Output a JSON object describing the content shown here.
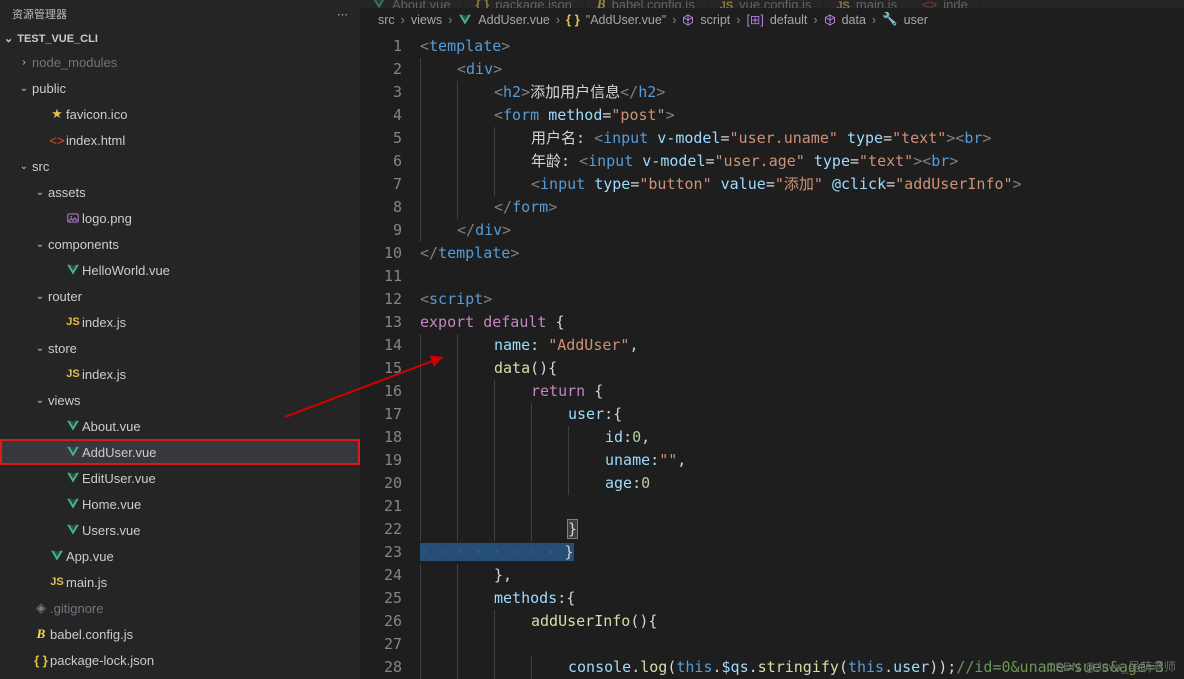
{
  "explorer_title": "资源管理器",
  "project": "TEST_VUE_CLI",
  "tree": [
    {
      "d": 1,
      "c": ">",
      "t": "folder",
      "l": "node_modules",
      "dim": true
    },
    {
      "d": 1,
      "c": "v",
      "t": "folder",
      "l": "public"
    },
    {
      "d": 2,
      "c": "",
      "t": "star",
      "l": "favicon.ico"
    },
    {
      "d": 2,
      "c": "",
      "t": "html",
      "l": "index.html"
    },
    {
      "d": 1,
      "c": "v",
      "t": "folder",
      "l": "src"
    },
    {
      "d": 2,
      "c": "v",
      "t": "folder",
      "l": "assets"
    },
    {
      "d": 3,
      "c": "",
      "t": "img",
      "l": "logo.png"
    },
    {
      "d": 2,
      "c": "v",
      "t": "folder",
      "l": "components"
    },
    {
      "d": 3,
      "c": "",
      "t": "vue",
      "l": "HelloWorld.vue"
    },
    {
      "d": 2,
      "c": "v",
      "t": "folder",
      "l": "router"
    },
    {
      "d": 3,
      "c": "",
      "t": "js",
      "l": "index.js"
    },
    {
      "d": 2,
      "c": "v",
      "t": "folder",
      "l": "store"
    },
    {
      "d": 3,
      "c": "",
      "t": "js",
      "l": "index.js"
    },
    {
      "d": 2,
      "c": "v",
      "t": "folder",
      "l": "views"
    },
    {
      "d": 3,
      "c": "",
      "t": "vue",
      "l": "About.vue"
    },
    {
      "d": 3,
      "c": "",
      "t": "vue",
      "l": "AddUser.vue",
      "sel": true
    },
    {
      "d": 3,
      "c": "",
      "t": "vue",
      "l": "EditUser.vue"
    },
    {
      "d": 3,
      "c": "",
      "t": "vue",
      "l": "Home.vue"
    },
    {
      "d": 3,
      "c": "",
      "t": "vue",
      "l": "Users.vue"
    },
    {
      "d": 2,
      "c": "",
      "t": "vue",
      "l": "App.vue"
    },
    {
      "d": 2,
      "c": "",
      "t": "js",
      "l": "main.js"
    },
    {
      "d": 1,
      "c": "",
      "t": "git",
      "l": ".gitignore",
      "dim": true
    },
    {
      "d": 1,
      "c": "",
      "t": "babel",
      "l": "babel.config.js"
    },
    {
      "d": 1,
      "c": "",
      "t": "json",
      "l": "package-lock.json"
    }
  ],
  "tabs": [
    {
      "icon": "vue",
      "l": "About.vue",
      "cut": true
    },
    {
      "icon": "json",
      "l": "package.json",
      "cut": true
    },
    {
      "icon": "babel",
      "l": "babel.config.js",
      "cut": true
    },
    {
      "icon": "js",
      "l": "vue.config.js",
      "cut": true
    },
    {
      "icon": "js",
      "l": "main.js",
      "cut": true
    },
    {
      "icon": "html",
      "l": "inde",
      "cut": true
    }
  ],
  "breadcrumbs": [
    "src",
    "views",
    "AddUser.vue",
    "\"AddUser.vue\"",
    "script",
    "default",
    "data",
    "user"
  ],
  "breadcrumb_icons": [
    "",
    "",
    "vue",
    "json",
    "cube",
    "bracket",
    "cube",
    "wrench"
  ],
  "line_start": 1,
  "line_end": 28,
  "code_text": {
    "h2": "添加用户信息",
    "lbl_user": "用户名: ",
    "lbl_age": "年龄: ",
    "attr_method": "method",
    "val_post": "post",
    "attr_vmodel": "v-model",
    "mdl_uname": "user.uname",
    "mdl_age": "user.age",
    "attr_type": "type",
    "val_text": "text",
    "val_button": "button",
    "attr_value": "value",
    "val_add": "添加",
    "attr_click": "@click",
    "val_addfn": "addUserInfo",
    "name_key": "name",
    "name_val": "AddUser",
    "data_fn": "data",
    "return_kw": "return",
    "user_key": "user",
    "id_key": "id",
    "id_val": "0",
    "uname_key": "uname",
    "uname_val": "\"\"",
    "age_key": "age",
    "age_val": "0",
    "methods_key": "methods",
    "addfn": "addUserInfo",
    "console": "console",
    "log": "log",
    "this": "this",
    "qs": "$qs",
    "stringify": "stringify",
    "user": "user",
    "comment": "//id=0&uname=sues&age=3",
    "template": "template",
    "div": "div",
    "h2tag": "h2",
    "form": "form",
    "input": "input",
    "br": "br",
    "script": "script",
    "export": "export",
    "default": "default"
  },
  "watermark": "CSDN @Java_吴萌老师"
}
